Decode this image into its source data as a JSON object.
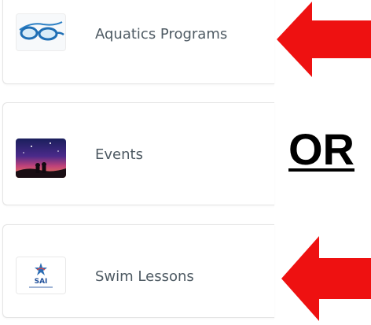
{
  "cards": [
    {
      "label": "Aquatics Programs",
      "thumbnail_icon": "swim-goggles-icon"
    },
    {
      "label": "Events",
      "thumbnail_icon": "night-sky-photo"
    },
    {
      "label": "Swim Lessons",
      "thumbnail_icon": "sai-logo",
      "logo_text": "SAI"
    }
  ],
  "annotation": {
    "or_text": "OR",
    "arrow_color": "#ee1111"
  }
}
